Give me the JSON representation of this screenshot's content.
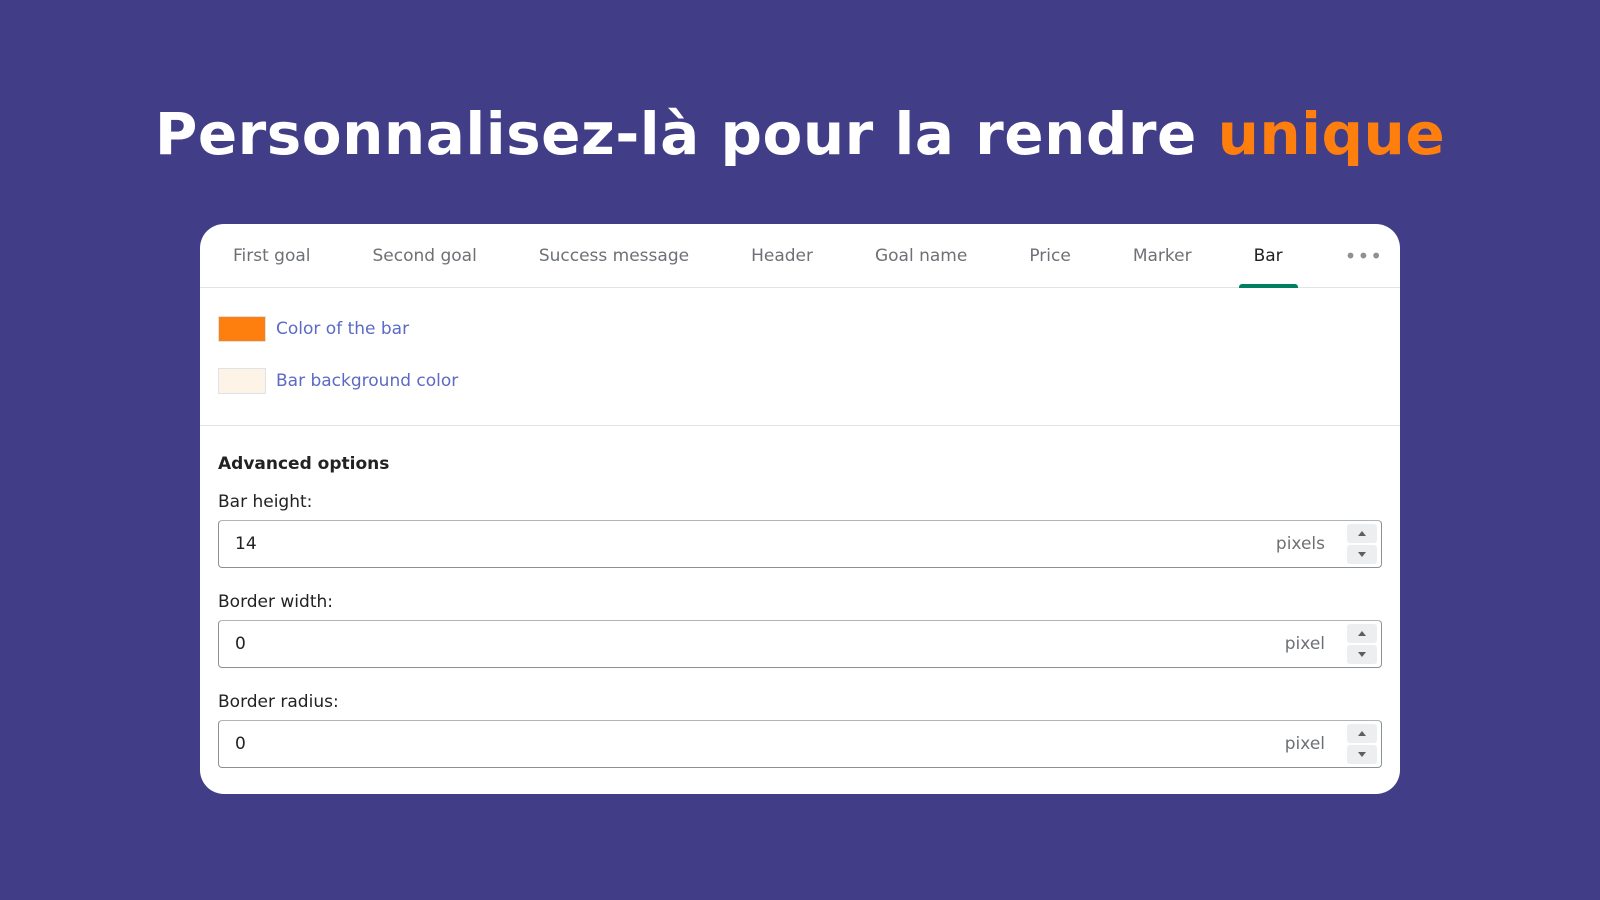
{
  "headline": {
    "text": "Personnalisez-là pour la rendre",
    "accent_text": "unique",
    "accent_color": "#ff7f0e"
  },
  "tabs": [
    {
      "label": "First goal",
      "active": false
    },
    {
      "label": "Second goal",
      "active": false
    },
    {
      "label": "Success message",
      "active": false
    },
    {
      "label": "Header",
      "active": false
    },
    {
      "label": "Goal name",
      "active": false
    },
    {
      "label": "Price",
      "active": false
    },
    {
      "label": "Marker",
      "active": false
    },
    {
      "label": "Bar",
      "active": true
    }
  ],
  "more_tabs_icon": "more-horizontal-icon",
  "more_tabs_glyph": "•••",
  "colors": [
    {
      "label": "Color of the bar",
      "value": "#ff7f0e"
    },
    {
      "label": "Bar background color",
      "value": "#fdf3e7"
    }
  ],
  "advanced": {
    "title": "Advanced options",
    "fields": [
      {
        "label": "Bar height:",
        "value": "14",
        "suffix": "pixels"
      },
      {
        "label": "Border width:",
        "value": "0",
        "suffix": "pixel"
      },
      {
        "label": "Border radius:",
        "value": "0",
        "suffix": "pixel"
      }
    ]
  },
  "theme": {
    "background": "#423d87",
    "active_tab_indicator": "#008060",
    "link_color": "#5c6ac4"
  }
}
